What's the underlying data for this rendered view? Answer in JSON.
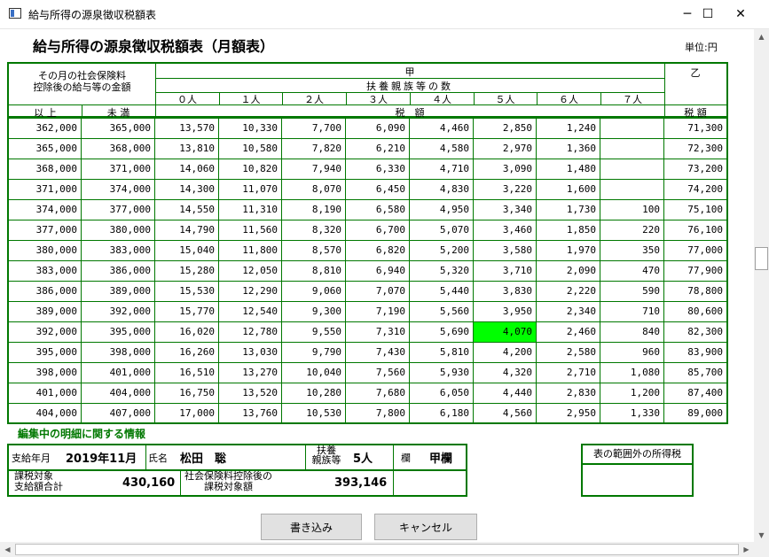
{
  "window": {
    "title": "給与所得の源泉徴収税額表",
    "minimize": "─",
    "maximize": "☐",
    "close": "✕"
  },
  "page": {
    "heading": "給与所得の源泉徴収税額表（月額表）",
    "unit": "単位:円"
  },
  "table_header": {
    "col_salary": "その月の社会保険料控除後の給与等の金額",
    "col_salary_line1": "その月の社会保険料",
    "col_salary_line2": "控除後の給与等の金額",
    "ko": "甲",
    "otsu": "乙",
    "dependents": "扶養親族等の数",
    "dependent_cols": [
      "０人",
      "１人",
      "２人",
      "３人",
      "４人",
      "５人",
      "６人",
      "７人"
    ],
    "ijo": "以 上",
    "miman": "未 満",
    "zeigaku": "税　額",
    "zeigaku_otsu": "税 額"
  },
  "rows": [
    [
      "362,000",
      "365,000",
      "13,570",
      "10,330",
      "7,700",
      "6,090",
      "4,460",
      "2,850",
      "1,240",
      "",
      "71,300"
    ],
    [
      "365,000",
      "368,000",
      "13,810",
      "10,580",
      "7,820",
      "6,210",
      "4,580",
      "2,970",
      "1,360",
      "",
      "72,300"
    ],
    [
      "368,000",
      "371,000",
      "14,060",
      "10,820",
      "7,940",
      "6,330",
      "4,710",
      "3,090",
      "1,480",
      "",
      "73,200"
    ],
    [
      "371,000",
      "374,000",
      "14,300",
      "11,070",
      "8,070",
      "6,450",
      "4,830",
      "3,220",
      "1,600",
      "",
      "74,200"
    ],
    [
      "374,000",
      "377,000",
      "14,550",
      "11,310",
      "8,190",
      "6,580",
      "4,950",
      "3,340",
      "1,730",
      "100",
      "75,100"
    ],
    [
      "377,000",
      "380,000",
      "14,790",
      "11,560",
      "8,320",
      "6,700",
      "5,070",
      "3,460",
      "1,850",
      "220",
      "76,100"
    ],
    [
      "380,000",
      "383,000",
      "15,040",
      "11,800",
      "8,570",
      "6,820",
      "5,200",
      "3,580",
      "1,970",
      "350",
      "77,000"
    ],
    [
      "383,000",
      "386,000",
      "15,280",
      "12,050",
      "8,810",
      "6,940",
      "5,320",
      "3,710",
      "2,090",
      "470",
      "77,900"
    ],
    [
      "386,000",
      "389,000",
      "15,530",
      "12,290",
      "9,060",
      "7,070",
      "5,440",
      "3,830",
      "2,220",
      "590",
      "78,800"
    ],
    [
      "389,000",
      "392,000",
      "15,770",
      "12,540",
      "9,300",
      "7,190",
      "5,560",
      "3,950",
      "2,340",
      "710",
      "80,600"
    ],
    [
      "392,000",
      "395,000",
      "16,020",
      "12,780",
      "9,550",
      "7,310",
      "5,690",
      "4,070",
      "2,460",
      "840",
      "82,300"
    ],
    [
      "395,000",
      "398,000",
      "16,260",
      "13,030",
      "9,790",
      "7,430",
      "5,810",
      "4,200",
      "2,580",
      "960",
      "83,900"
    ],
    [
      "398,000",
      "401,000",
      "16,510",
      "13,270",
      "10,040",
      "7,560",
      "5,930",
      "4,320",
      "2,710",
      "1,080",
      "85,700"
    ],
    [
      "401,000",
      "404,000",
      "16,750",
      "13,520",
      "10,280",
      "7,680",
      "6,050",
      "4,440",
      "2,830",
      "1,200",
      "87,400"
    ],
    [
      "404,000",
      "407,000",
      "17,000",
      "13,760",
      "10,530",
      "7,800",
      "6,180",
      "4,560",
      "2,950",
      "1,330",
      "89,000"
    ]
  ],
  "highlight": {
    "row": 10,
    "col": 7,
    "color": "#00ff00"
  },
  "info": {
    "section_title": "編集中の明細に関する情報",
    "pay_month_label": "支給年月",
    "pay_month_value": "2019年11月",
    "name_label": "氏名",
    "name_value": "松田　聡",
    "dependents_label_1": "扶養",
    "dependents_label_2": "親族等",
    "dependents_value": "5人",
    "column_label": "欄",
    "column_value": "甲欄",
    "taxable_label_1": "課税対象",
    "taxable_label_2": "支給額合計",
    "taxable_value": "430,160",
    "after_ins_label_1": "社会保険料控除後の",
    "after_ins_label_2": "課税対象額",
    "after_ins_value": "393,146",
    "out_of_range_label": "表の範囲外の所得税",
    "out_of_range_value": ""
  },
  "buttons": {
    "write": "書き込み",
    "cancel": "キャンセル"
  },
  "colors": {
    "border": "#007800",
    "highlight": "#00ff00"
  }
}
